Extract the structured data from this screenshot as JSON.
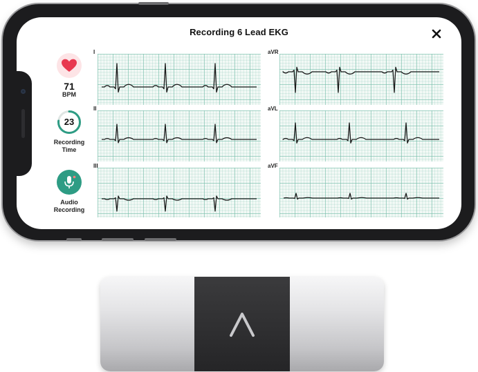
{
  "header": {
    "title": "Recording 6 Lead EKG",
    "close_icon": "close-icon"
  },
  "stats": {
    "heart_rate": {
      "icon": "heart-icon",
      "value": "71",
      "label": "BPM"
    },
    "recording_time": {
      "icon": "progress-ring-icon",
      "value": "23",
      "label_line1": "Recording",
      "label_line2": "Time",
      "progress_fraction": 0.77
    },
    "audio": {
      "icon": "microphone-icon",
      "label_line1": "Audio",
      "label_line2": "Recording"
    }
  },
  "leads": [
    {
      "id": "lead-i",
      "label": "I"
    },
    {
      "id": "lead-avr",
      "label": "aVR"
    },
    {
      "id": "lead-ii",
      "label": "II"
    },
    {
      "id": "lead-avl",
      "label": "aVL"
    },
    {
      "id": "lead-iii",
      "label": "III"
    },
    {
      "id": "lead-avf",
      "label": "aVF"
    }
  ],
  "device": {
    "logo_icon": "alivecor-chevron-logo-icon"
  },
  "colors": {
    "accent_teal": "#2e9c84",
    "heart_red": "#e8384f",
    "trace": "#1a1a1a"
  }
}
